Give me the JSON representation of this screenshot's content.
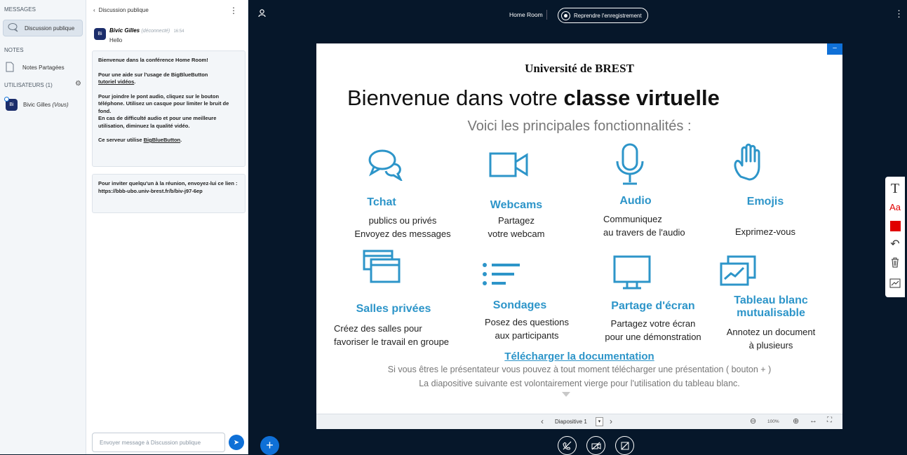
{
  "userlist": {
    "messages_header": "MESSAGES",
    "public_chat_label": "Discussion publique",
    "notes_header": "NOTES",
    "shared_notes_label": "Notes Partagées",
    "users_header": "UTILISATEURS (1)",
    "user_initials": "Bi",
    "user_name": "Bivic Gilles",
    "user_suffix": "(Vous)"
  },
  "chat": {
    "back_label": "Discussion publique",
    "msg_author": "Bivic Gilles",
    "msg_status": "(déconnecté)",
    "msg_time": "16:54",
    "msg_text": "Hello",
    "welcome_prefix": "Bienvenue dans la conférence ",
    "welcome_room": "Home Room",
    "welcome_suffix": "!",
    "help_text": "Pour une aide sur l'usage de BigBlueButton",
    "help_link": "tutoriel vidéos",
    "help_end": ".",
    "audio_text": "Pour joindre le pont audio, cliquez sur le bouton téléphone. Utilisez un casque pour limiter le bruit de fond.",
    "audio_text2": "En cas de difficulté audio et pour une meilleure utilisation, diminuez la qualité vidéo.",
    "server_text": "Ce serveur utilise ",
    "server_link": "BigBlueButton",
    "server_end": ".",
    "invite_text": "Pour inviter quelqu'un à la réunion, envoyez-lui ce lien : https://bbb-ubo.univ-brest.fr/b/biv-j97-6ep",
    "input_placeholder": "Envoyer message à Discussion publique"
  },
  "topbar": {
    "room_title": "Home Room",
    "record_label": "Reprendre l'enregistrement"
  },
  "slide": {
    "university": "Université  de BREST",
    "title_regular": "Bienvenue dans votre ",
    "title_bold": "classe virtuelle",
    "subtitle": "Voici les principales fonctionnalités :",
    "features": [
      {
        "title": "Tchat",
        "line1": "publics ou privés",
        "line2": "Envoyez des messages"
      },
      {
        "title": "Webcams",
        "line1": "Partagez",
        "line2": "votre webcam"
      },
      {
        "title": "Audio",
        "line1": "Communiquez",
        "line2": "au travers de l'audio"
      },
      {
        "title": "Emojis",
        "line1": "Exprimez-vous",
        "line2": ""
      },
      {
        "title": "Salles privées",
        "line1": "Créez des salles pour",
        "line2": "favoriser le travail en groupe"
      },
      {
        "title": "Sondages",
        "line1": "Posez des questions",
        "line2": "aux participants"
      },
      {
        "title": "Partage d'écran",
        "line1": "Partagez votre écran",
        "line2": "pour une démonstration"
      },
      {
        "title": "Tableau blanc",
        "title2": "mutualisable",
        "line1": "Annotez un document",
        "line2": "à plusieurs"
      }
    ],
    "download": "Télécharger la documentation",
    "footer1": "Si vous êtres le présentateur vous pouvez à tout moment télécharger une présentation ( bouton + )",
    "footer2": "La diapositive suivante est volontairement vierge pour l'utilisation du tableau blanc.",
    "slide_select": "Diapositive 1",
    "zoom": "100%"
  },
  "tools": [
    "T",
    "Aa",
    "",
    "⤺",
    "🗑",
    "⟋"
  ],
  "colors": {
    "accent": "#0f70d7",
    "slide_blue": "#2d95c9",
    "bg": "#06172a",
    "tool_red": "#e00000"
  }
}
